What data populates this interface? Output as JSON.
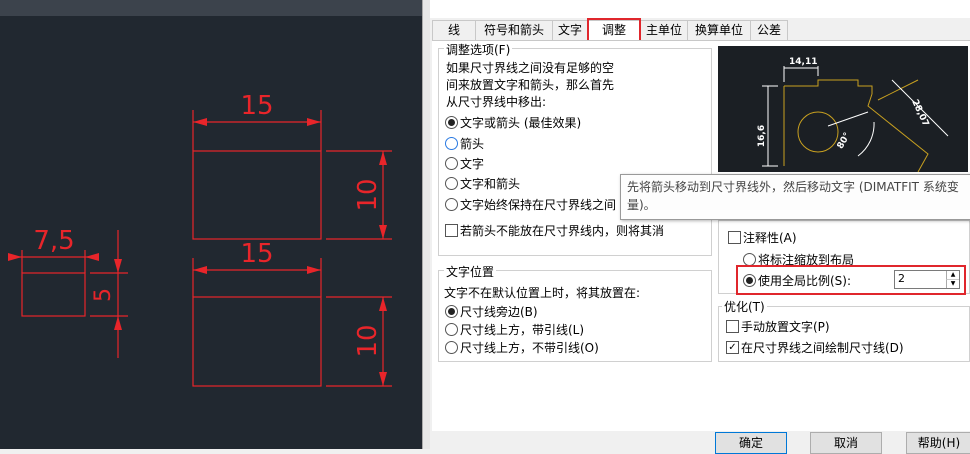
{
  "cad": {
    "dims": {
      "top_width": "15",
      "top_height": "10",
      "bottom_width": "15",
      "bottom_height": "10",
      "small_width": "7,5",
      "small_height": "5"
    }
  },
  "tabs": [
    "线",
    "符号和箭头",
    "文字",
    "调整",
    "主单位",
    "换算单位",
    "公差"
  ],
  "fit_options": {
    "legend": "调整选项(F)",
    "description": [
      "如果尺寸界线之间没有足够的空",
      "间来放置文字和箭头，那么首先",
      "从尺寸界线中移出:"
    ],
    "options": [
      "文字或箭头 (最佳效果)",
      "箭头",
      "文字",
      "文字和箭头",
      "文字始终保持在尺寸界线之间"
    ],
    "suppress_label": "若箭头不能放在尺寸界线内，则将其消"
  },
  "preview": {
    "labels": [
      "14,11",
      "16,6",
      "28,07",
      "80°"
    ]
  },
  "tooltip": {
    "line1": "先将箭头移动到尺寸界线外，然后移动文字 (DIMATFIT 系统变",
    "line2": "量)。"
  },
  "scale": {
    "annotative_label": "注释性(A)",
    "layout_label": "将标注缩放到布局",
    "global_label": "使用全局比例(S):",
    "global_value": "2"
  },
  "text_placement": {
    "legend": "文字位置",
    "description": "文字不在默认位置上时，将其放置在:",
    "options": [
      "尺寸线旁边(B)",
      "尺寸线上方，带引线(L)",
      "尺寸线上方，不带引线(O)"
    ]
  },
  "fine_tuning": {
    "legend": "优化(T)",
    "manual_label": "手动放置文字(P)",
    "draw_line_label": "在尺寸界线之间绘制尺寸线(D)"
  },
  "buttons": {
    "ok": "确定",
    "cancel": "取消",
    "help": "帮助(H)"
  },
  "colors": {
    "cad_background": "#212830",
    "cad_red": "#e8252a",
    "highlight_red": "#e0262c",
    "preview_background": "#1b1f24",
    "preview_gold": "#c8a020"
  }
}
